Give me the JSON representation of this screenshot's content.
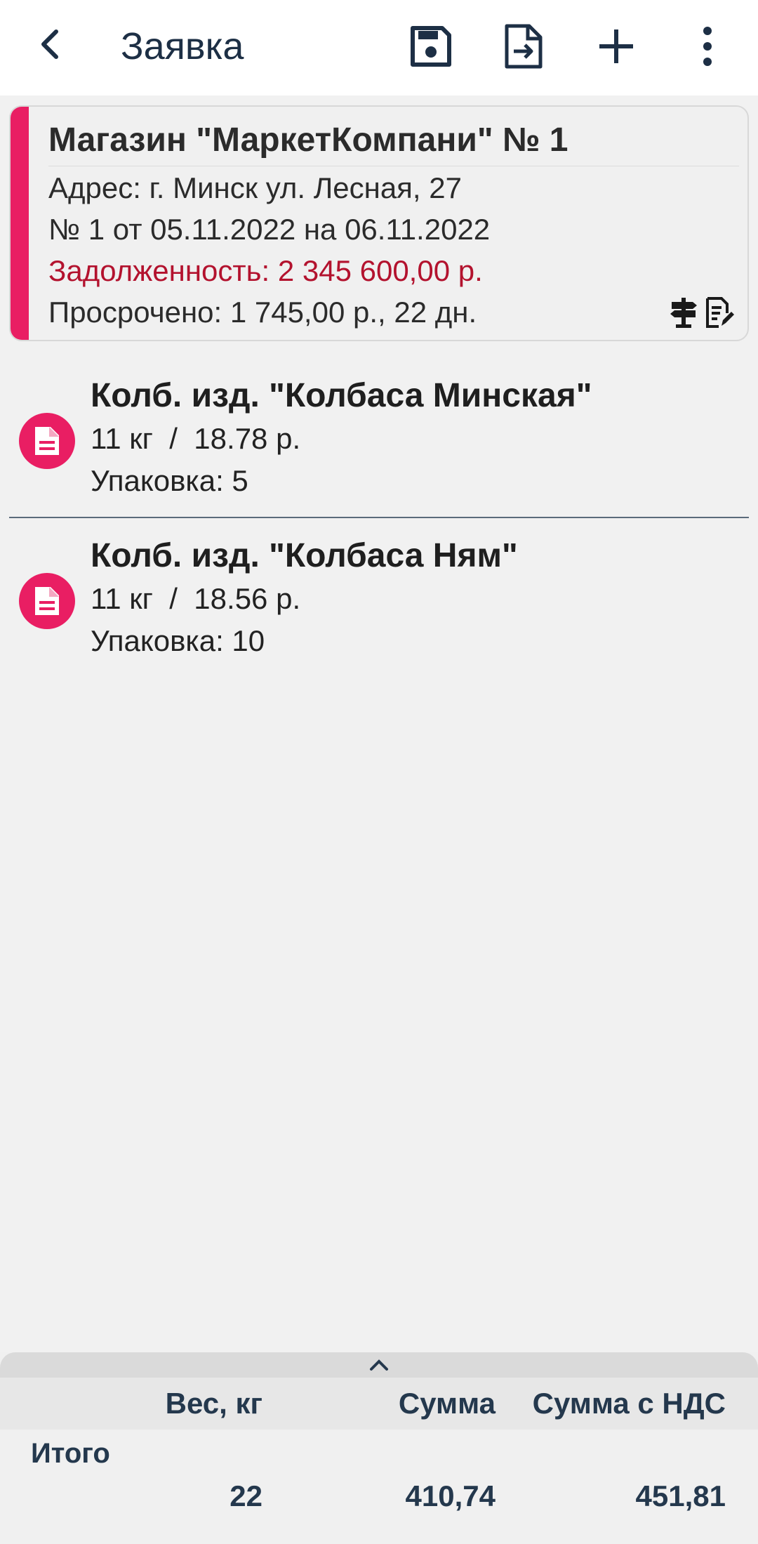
{
  "appbar": {
    "title": "Заявка",
    "back_icon": "chevron-left-icon",
    "actions": [
      "save-icon",
      "file-export-icon",
      "plus-icon",
      "more-vert-icon"
    ]
  },
  "header_card": {
    "store": "Магазин \"МаркетКомпани\" № 1",
    "address": "Адрес: г. Минск ул. Лесная, 27",
    "order": "№ 1 от 05.11.2022 на 06.11.2022",
    "debt": "Задолженность: 2 345 600,00 р.",
    "overdue": "Просрочено: 1 745,00 р., 22 дн.",
    "accent_color": "#e91e63",
    "debt_color": "#b3122e"
  },
  "items": [
    {
      "name": "Колб. изд. \"Колбаса Минская\"",
      "qty_price": "11 кг  /  18.78 р.",
      "pack": "Упаковка: 5"
    },
    {
      "name": "Колб. изд. \"Колбаса Ням\"",
      "qty_price": "11 кг  /  18.56 р.",
      "pack": "Упаковка: 10"
    }
  ],
  "totals": {
    "headers": {
      "weight": "Вес, кг",
      "sum": "Сумма",
      "sum_vat": "Сумма с НДС"
    },
    "row_label": "Итого",
    "weight": "22",
    "sum": "410,74",
    "sum_vat": "451,81"
  }
}
